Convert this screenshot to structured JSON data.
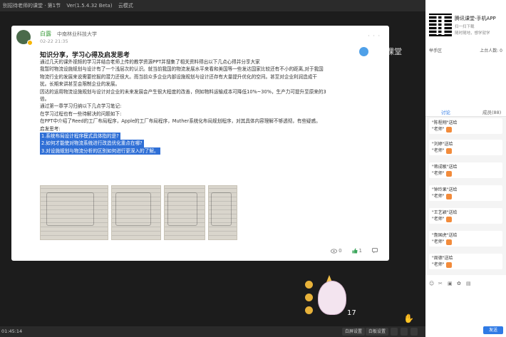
{
  "titlebar": {
    "segments": [
      "别招待老师的课堂 · 第1节",
      "Ver(1.5.4.32 Beta)",
      "云模式",
      "□"
    ]
  },
  "post": {
    "author": "白露",
    "school": "中南林业科技大学",
    "date": "02-22 21:35",
    "more": "· · ·",
    "title": "知识分享，学习心得及启发思考",
    "lines": [
      "通过几天的课外视频的学习并结合老师上传的教学资源PPT并搜集了相关资料得出以下几点心得并分享大家",
      "我暂时物流设施规划与设计有了一个浅层次的认识。就当前我国的物流发展水平来看和美国等一些发达国家比较还有不小的距离,对于我国",
      "物流行业的发展来说需要挖掘的潜力还很大。而当前众多企业内部设施规划与设计还存有大量提升优化的空间。甚至对企业利润造成干",
      "扰。长期来讲甚至会限制企业的发展。",
      "因达的运用物流设施规划与设计对企业的未来发展会产生很大程度的改善，例如物料运输成本可降低10%~30%，生产力可提升至原来的3",
      "倍。",
      "通过第一章学习归纳以下几点学习笔记:",
      "在学习过程也有一些待解决的问题如下:",
      "在PPT中介绍了Reed的工厂布局程序，Apple的工厂布局程序，Muther系统化布局规划程序，对其具体内容理解不够透彻，有些疑惑。",
      "启发思考:"
    ],
    "highlights": [
      "1.系统布局设计程序模式具体指的是?",
      "2.如何才能使对物流系统进行改造优化重点在哪?",
      "3.对设施规划与物流分析的区别如何进行更深入的了解。"
    ],
    "actions": {
      "views": "0",
      "likes": "1",
      "comments": ""
    }
  },
  "watermark": "腾讯课堂",
  "mascot_count": "17",
  "bottombar": {
    "time": "01:45:14",
    "buttons": [
      "白屏设置",
      "白板设置",
      "",
      "",
      ""
    ]
  },
  "right": {
    "app_title": "腾讯课堂-手机APP",
    "app_sub1": "扫一扫下载",
    "app_sub2": "随时随地，想学就学",
    "raise_left": "举手区",
    "raise_right": "上台人数: 0",
    "tab_discussion": "讨论",
    "tab_members": "成员(88)",
    "messages": [
      {
        "sender": "\"陈程翔\"送给",
        "target": "\"老师\""
      },
      {
        "sender": "\"刘婷\"送给",
        "target": "\"老师\""
      },
      {
        "sender": "\"蒋成敏\"送给",
        "target": "\"老师\""
      },
      {
        "sender": "\"钟玲果\"送给",
        "target": "\"老师\""
      },
      {
        "sender": "\"王艺颖\"送给",
        "target": "\"老师\""
      },
      {
        "sender": "\"詹国虎\"送给",
        "target": "\"老师\""
      },
      {
        "sender": "\"周德\"送给",
        "target": "\"老师\""
      }
    ],
    "send_label": "发送"
  }
}
